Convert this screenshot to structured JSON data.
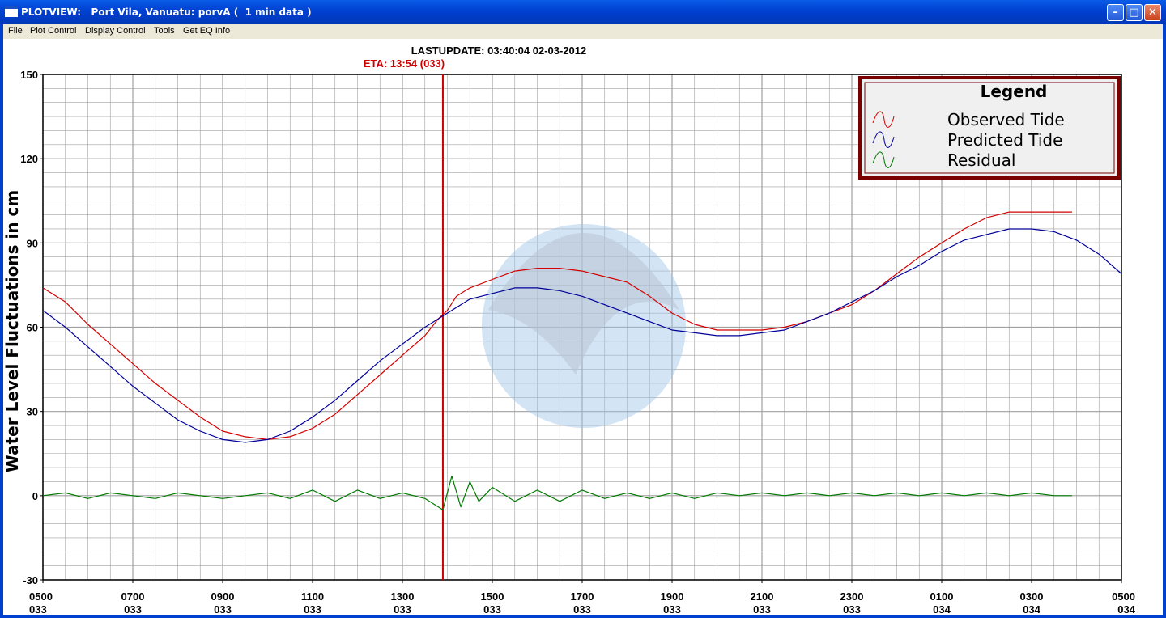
{
  "window": {
    "title": "PLOTVIEW:   Port Vila, Vanuatu: porvA (  1 min data )",
    "min_glyph": "–",
    "max_glyph": "□",
    "close_glyph": "✕"
  },
  "menu": [
    "File",
    "Plot Control",
    "Display Control",
    "Tools",
    "Get EQ Info"
  ],
  "colors": {
    "observed": "#d40000",
    "predicted": "#000099",
    "residual": "#007a00",
    "eta_line": "#cc0000",
    "legend_border": "#7a0000",
    "legend_bg": "#f0f0f0",
    "grid": "#a0a0a0",
    "watermark": "#9dc3e6"
  },
  "chart_data": {
    "type": "line",
    "header": "LASTUPDATE: 03:40:04  02-03-2012",
    "eta_label": "ETA: 13:54 (033)",
    "eta_x_hours": 8.9,
    "ylabel": "Water Level Fluctuations in cm",
    "xlabel": "",
    "ylim": [
      -30,
      150
    ],
    "y_ticks": [
      150,
      120,
      90,
      60,
      30,
      0,
      -30
    ],
    "xlim_hours": [
      0,
      24
    ],
    "x_ticks": [
      {
        "h": 0,
        "time": "0500",
        "day": "033"
      },
      {
        "h": 2,
        "time": "0700",
        "day": "033"
      },
      {
        "h": 4,
        "time": "0900",
        "day": "033"
      },
      {
        "h": 6,
        "time": "1100",
        "day": "033"
      },
      {
        "h": 8,
        "time": "1300",
        "day": "033"
      },
      {
        "h": 10,
        "time": "1500",
        "day": "033"
      },
      {
        "h": 12,
        "time": "1700",
        "day": "033"
      },
      {
        "h": 14,
        "time": "1900",
        "day": "033"
      },
      {
        "h": 16,
        "time": "2100",
        "day": "033"
      },
      {
        "h": 18,
        "time": "2300",
        "day": "033"
      },
      {
        "h": 20,
        "time": "0100",
        "day": "034"
      },
      {
        "h": 22,
        "time": "0300",
        "day": "034"
      },
      {
        "h": 24,
        "time": "0500",
        "day": "034"
      }
    ],
    "grid": true,
    "legend": {
      "title": "Legend",
      "placement": "top-right",
      "entries": [
        "Observed Tide",
        "Predicted Tide",
        "Residual"
      ]
    },
    "series": [
      {
        "name": "Observed Tide",
        "x": [
          0,
          0.5,
          1,
          1.5,
          2,
          2.5,
          3,
          3.5,
          4,
          4.5,
          5,
          5.5,
          6,
          6.5,
          7,
          7.5,
          8,
          8.5,
          8.8,
          9,
          9.2,
          9.5,
          10,
          10.5,
          11,
          11.5,
          12,
          12.5,
          13,
          13.5,
          14,
          14.5,
          15,
          15.5,
          16,
          16.5,
          17,
          17.5,
          18,
          18.5,
          19,
          19.5,
          20,
          20.5,
          21,
          21.5,
          22,
          22.5,
          22.9
        ],
        "y": [
          74,
          69,
          61,
          54,
          47,
          40,
          34,
          28,
          23,
          21,
          20,
          21,
          24,
          29,
          36,
          43,
          50,
          57,
          63,
          66,
          71,
          74,
          77,
          80,
          81,
          81,
          80,
          78,
          76,
          71,
          65,
          61,
          59,
          59,
          59,
          60,
          62,
          65,
          68,
          73,
          79,
          85,
          90,
          95,
          99,
          101,
          101,
          101,
          101
        ]
      },
      {
        "name": "Predicted Tide",
        "x": [
          0,
          0.5,
          1,
          1.5,
          2,
          2.5,
          3,
          3.5,
          4,
          4.5,
          5,
          5.5,
          6,
          6.5,
          7,
          7.5,
          8,
          8.5,
          9,
          9.5,
          10,
          10.5,
          11,
          11.5,
          12,
          12.5,
          13,
          13.5,
          14,
          14.5,
          15,
          15.5,
          16,
          16.5,
          17,
          17.5,
          18,
          18.5,
          19,
          19.5,
          20,
          20.5,
          21,
          21.5,
          22,
          22.5,
          23,
          23.5,
          24
        ],
        "y": [
          66,
          60,
          53,
          46,
          39,
          33,
          27,
          23,
          20,
          19,
          20,
          23,
          28,
          34,
          41,
          48,
          54,
          60,
          65,
          70,
          72,
          74,
          74,
          73,
          71,
          68,
          65,
          62,
          59,
          58,
          57,
          57,
          58,
          59,
          62,
          65,
          69,
          73,
          78,
          82,
          87,
          91,
          93,
          95,
          95,
          94,
          91,
          86,
          79
        ]
      },
      {
        "name": "Residual",
        "x": [
          0,
          0.5,
          1,
          1.5,
          2,
          2.5,
          3,
          3.5,
          4,
          4.5,
          5,
          5.5,
          6,
          6.5,
          7,
          7.5,
          8,
          8.5,
          8.9,
          9.1,
          9.3,
          9.5,
          9.7,
          10,
          10.5,
          11,
          11.5,
          12,
          12.5,
          13,
          13.5,
          14,
          14.5,
          15,
          15.5,
          16,
          16.5,
          17,
          17.5,
          18,
          18.5,
          19,
          19.5,
          20,
          20.5,
          21,
          21.5,
          22,
          22.5,
          22.9
        ],
        "y": [
          0,
          1,
          -1,
          1,
          0,
          -1,
          1,
          0,
          -1,
          0,
          1,
          -1,
          2,
          -2,
          2,
          -1,
          1,
          -1,
          -5,
          7,
          -4,
          5,
          -2,
          3,
          -2,
          2,
          -2,
          2,
          -1,
          1,
          -1,
          1,
          -1,
          1,
          0,
          1,
          0,
          1,
          0,
          1,
          0,
          1,
          0,
          1,
          0,
          1,
          0,
          1,
          0,
          0
        ]
      }
    ]
  }
}
